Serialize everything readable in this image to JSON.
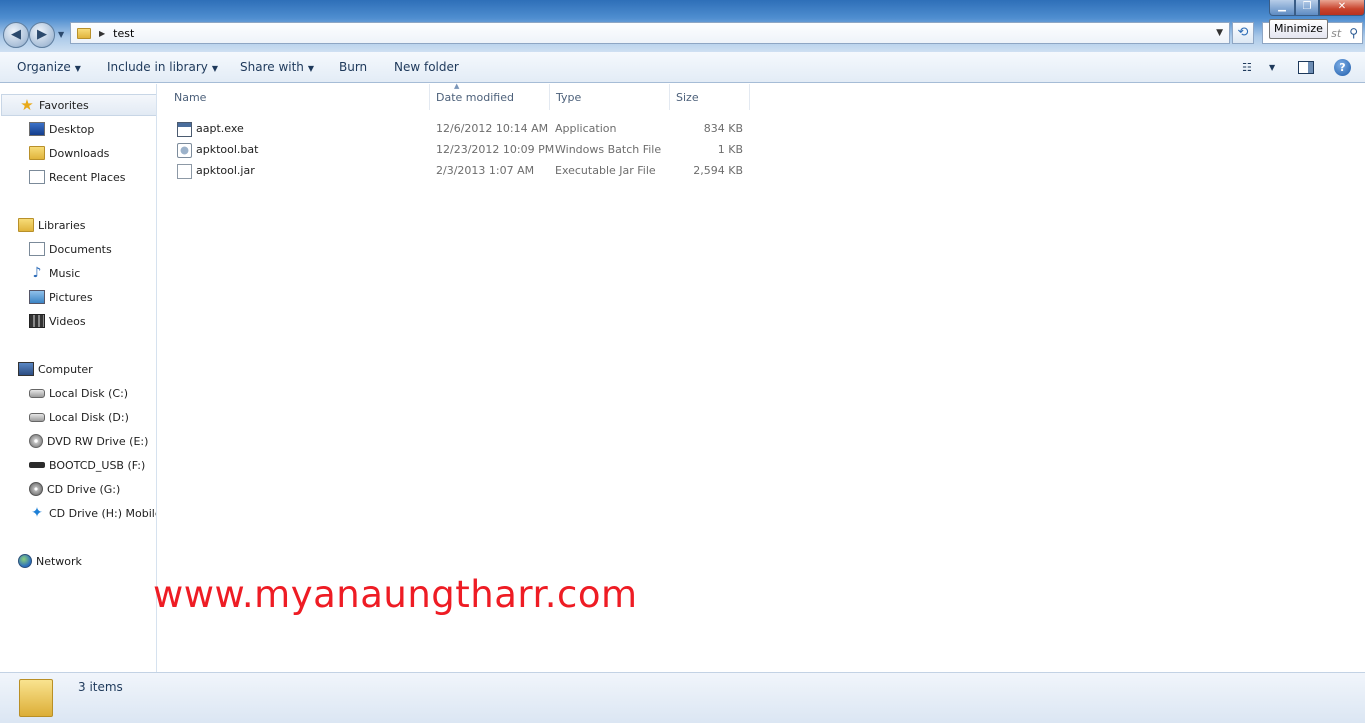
{
  "window": {
    "tooltip": "Minimize",
    "minimize_glyph": "▁",
    "maximize_glyph": "❐",
    "close_glyph": "✕"
  },
  "address_bar": {
    "path": "test",
    "back_glyph": "◀",
    "forward_glyph": "▶",
    "refresh_glyph": "⟲",
    "search_placeholder": "st",
    "search_glyph": "⚲"
  },
  "toolbar": {
    "organize": "Organize",
    "include_in_library": "Include in library",
    "share_with": "Share with",
    "burn": "Burn",
    "new_folder": "New folder",
    "help": "?"
  },
  "navigation": {
    "favorites": {
      "label": "Favorites",
      "items": [
        "Desktop",
        "Downloads",
        "Recent Places"
      ]
    },
    "libraries": {
      "label": "Libraries",
      "items": [
        "Documents",
        "Music",
        "Pictures",
        "Videos"
      ]
    },
    "computer": {
      "label": "Computer",
      "items": [
        "Local Disk (C:)",
        "Local Disk (D:)",
        "DVD RW Drive (E:)",
        "BOOTCD_USB (F:)",
        "CD Drive (G:)",
        "CD Drive (H:) Mobile P"
      ]
    },
    "network": {
      "label": "Network"
    }
  },
  "file_list": {
    "columns": [
      "Name",
      "Date modified",
      "Type",
      "Size"
    ],
    "rows": [
      {
        "name": "aapt.exe",
        "date": "12/6/2012 10:14 AM",
        "type": "Application",
        "size": "834 KB",
        "icon": "exe-icon"
      },
      {
        "name": "apktool.bat",
        "date": "12/23/2012 10:09 PM",
        "type": "Windows Batch File",
        "size": "1 KB",
        "icon": "bat-icon"
      },
      {
        "name": "apktool.jar",
        "date": "2/3/2013 1:07 AM",
        "type": "Executable Jar File",
        "size": "2,594 KB",
        "icon": "jar-icon"
      }
    ]
  },
  "watermark": "www.myanaungtharr.com",
  "status": {
    "items_count": "3 items"
  }
}
